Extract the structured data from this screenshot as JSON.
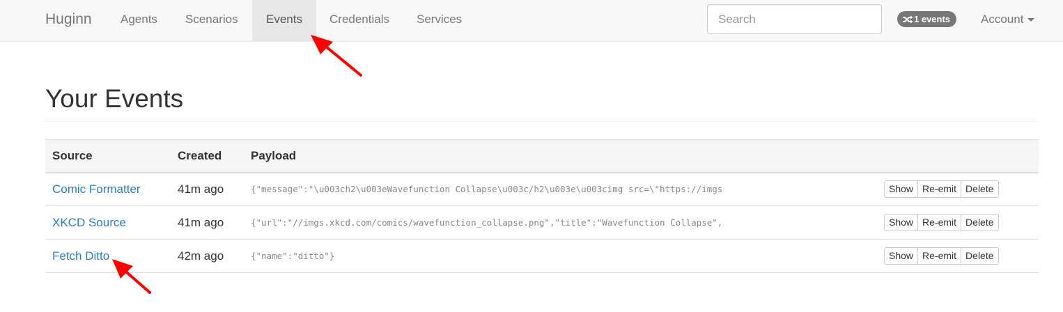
{
  "navbar": {
    "brand": "Huginn",
    "items": [
      {
        "label": "Agents"
      },
      {
        "label": "Scenarios"
      },
      {
        "label": "Events"
      },
      {
        "label": "Credentials"
      },
      {
        "label": "Services"
      }
    ],
    "active": "Events",
    "search_placeholder": "Search",
    "events_badge": "1 events",
    "account_label": "Account"
  },
  "page": {
    "title": "Your Events"
  },
  "table": {
    "headers": [
      "Source",
      "Created",
      "Payload"
    ],
    "rows": [
      {
        "source": "Comic Formatter",
        "created": "41m ago",
        "payload": "{\"message\":\"\\u003ch2\\u003eWavefunction Collapse\\u003c/h2\\u003e\\u003cimg src=\\\"https://imgs"
      },
      {
        "source": "XKCD Source",
        "created": "41m ago",
        "payload": "{\"url\":\"//imgs.xkcd.com/comics/wavefunction_collapse.png\",\"title\":\"Wavefunction Collapse\","
      },
      {
        "source": "Fetch Ditto",
        "created": "42m ago",
        "payload": "{\"name\":\"ditto\"}"
      }
    ],
    "actions": {
      "show": "Show",
      "reemit": "Re-emit",
      "delete": "Delete"
    }
  },
  "colors": {
    "link": "#337ab7",
    "navbar_bg": "#f8f8f8",
    "badge_bg": "#777777",
    "annotation_arrow": "#ff0000"
  }
}
